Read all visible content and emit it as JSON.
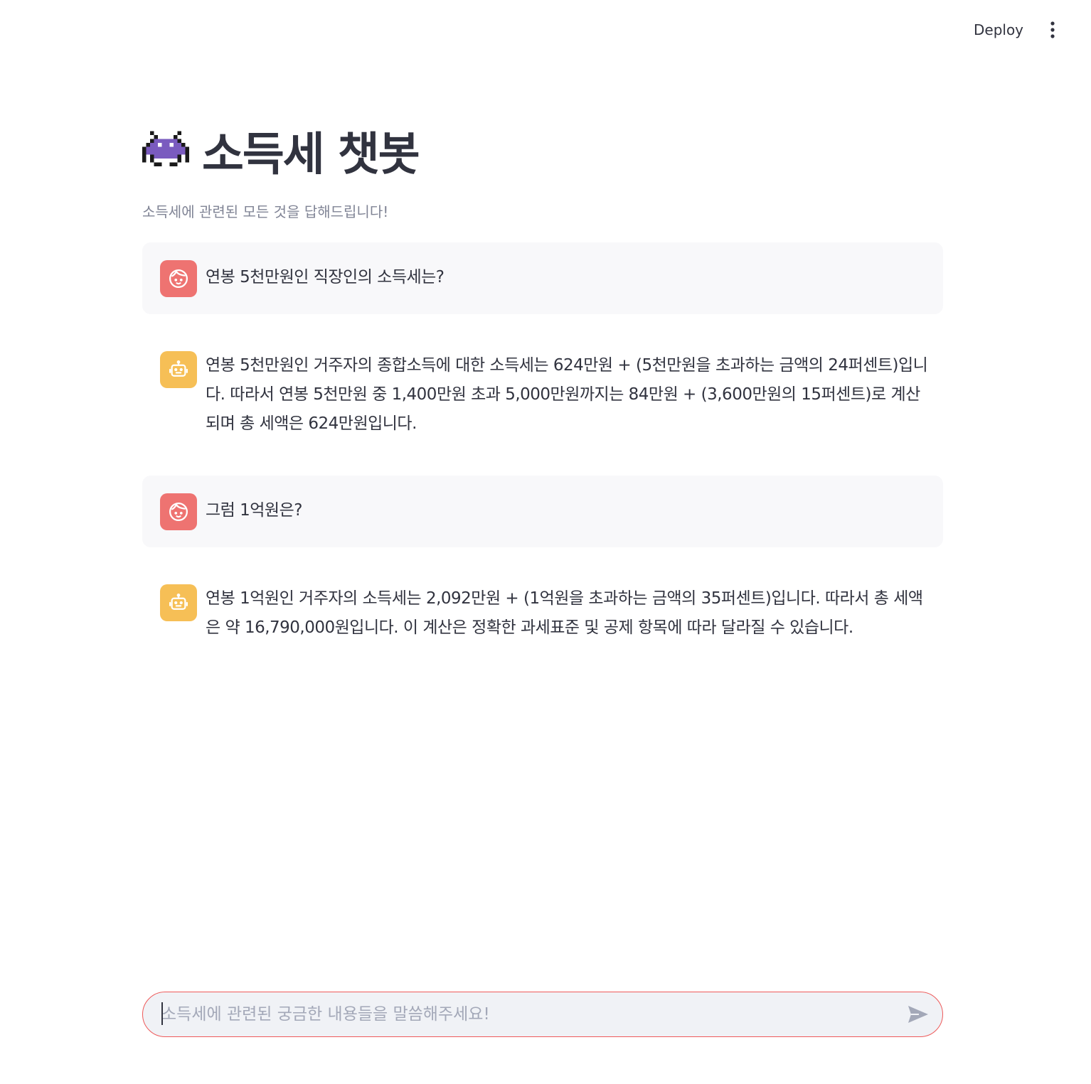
{
  "header": {
    "deploy_label": "Deploy",
    "menu_icon": "more-vertical-icon"
  },
  "page": {
    "title_icon": "alien-monster-icon",
    "title": "소득세 챗봇",
    "subtitle": "소득세에 관련된 모든 것을 답해드립니다!"
  },
  "messages": [
    {
      "role": "user",
      "avatar_icon": "user-face-icon",
      "text": "연봉 5천만원인 직장인의 소득세는?"
    },
    {
      "role": "assistant",
      "avatar_icon": "robot-icon",
      "text": "연봉 5천만원인 거주자의 종합소득에 대한 소득세는 624만원 + (5천만원을 초과하는 금액의 24퍼센트)입니다. 따라서 연봉 5천만원 중 1,400만원 초과 5,000만원까지는 84만원 + (3,600만원의 15퍼센트)로 계산되며 총 세액은 624만원입니다."
    },
    {
      "role": "user",
      "avatar_icon": "user-face-icon",
      "text": "그럼 1억원은?"
    },
    {
      "role": "assistant",
      "avatar_icon": "robot-icon",
      "text": "연봉 1억원인 거주자의 소득세는 2,092만원 + (1억원을 초과하는 금액의 35퍼센트)입니다. 따라서 총 세액은 약 16,790,000원입니다. 이 계산은 정확한 과세표준 및 공제 항목에 따라 달라질 수 있습니다."
    }
  ],
  "chat_input": {
    "value": "",
    "placeholder": "소득세에 관련된 궁금한 내용들을 말씀해주세요!",
    "send_icon": "send-icon"
  },
  "colors": {
    "user_avatar": "#ee7371",
    "assistant_avatar": "#f6bf56",
    "input_border": "#ee5a5a",
    "user_bubble": "#f8f8fa"
  }
}
